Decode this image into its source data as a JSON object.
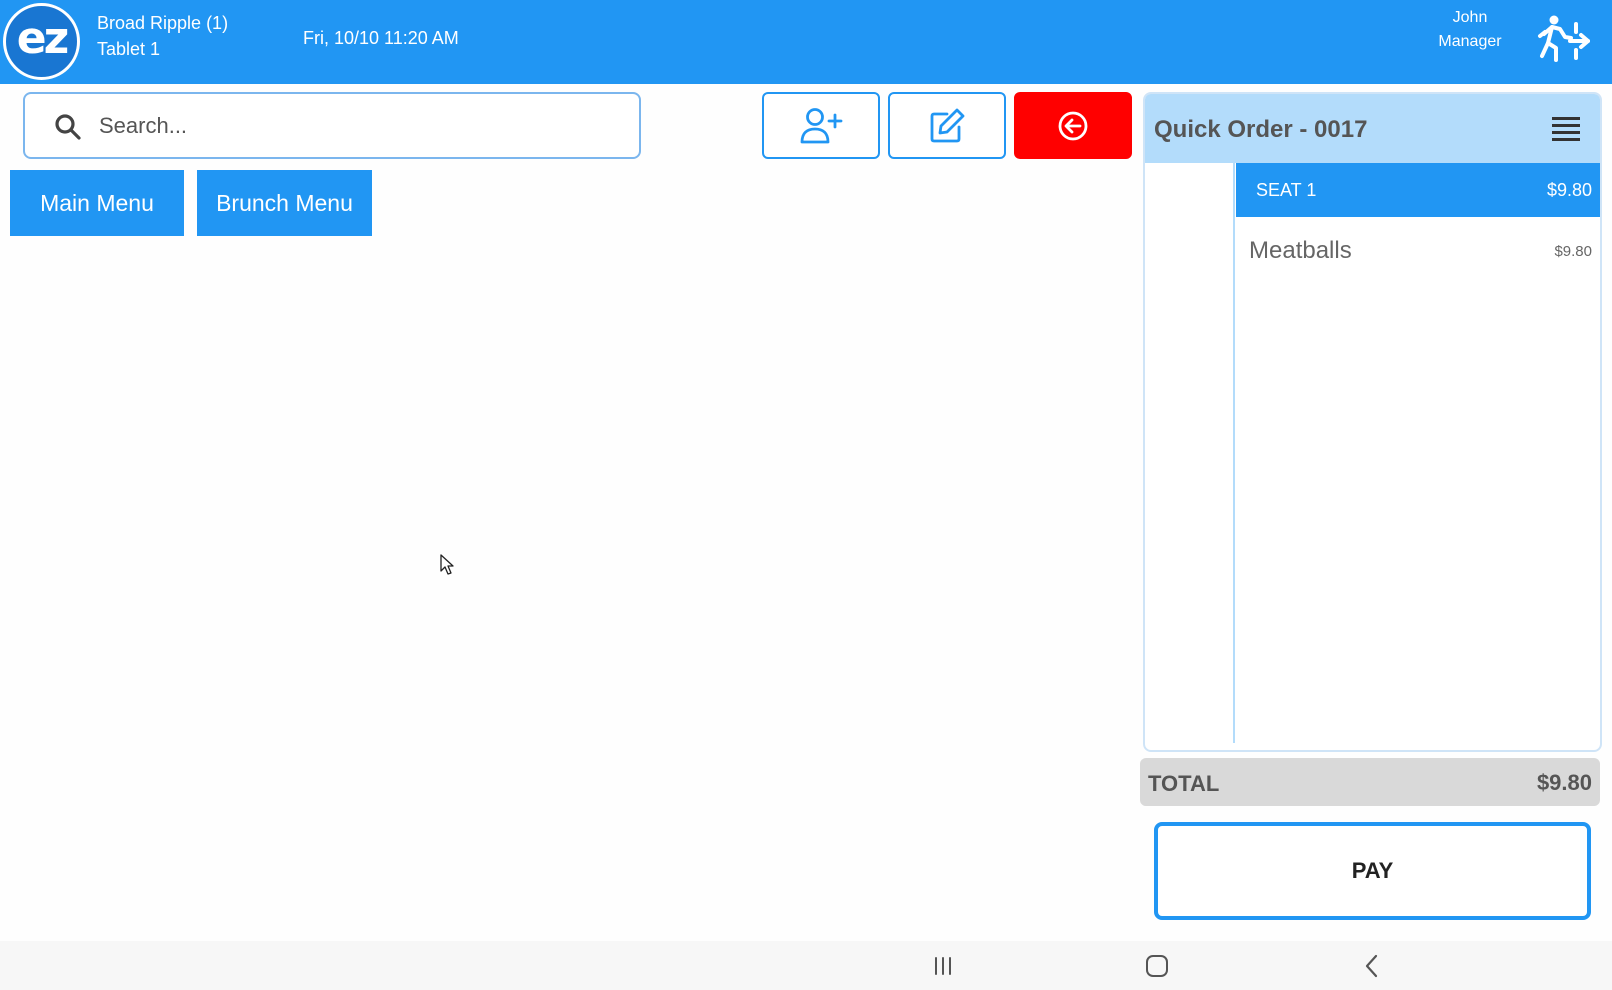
{
  "header": {
    "logo_text": "ez",
    "location": "Broad Ripple (1)",
    "device": "Tablet 1",
    "datetime": "Fri, 10/10 11:20 AM",
    "user_name": "John",
    "user_role": "Manager",
    "logout_icon": "exit-running-icon"
  },
  "search": {
    "placeholder": "Search...",
    "icon": "search-icon"
  },
  "toolbar": {
    "add_customer_icon": "user-plus-icon",
    "edit_icon": "edit-pencil-icon",
    "back_icon": "circle-arrow-left-icon"
  },
  "menus": [
    {
      "label": "Main Menu"
    },
    {
      "label": "Brunch Menu"
    }
  ],
  "order": {
    "title": "Quick Order - 0017",
    "menu_icon": "hamburger-icon",
    "seat": {
      "label": "SEAT 1",
      "amount": "$9.80"
    },
    "items": [
      {
        "name": "Meatballs",
        "price": "$9.80"
      }
    ],
    "total_label": "TOTAL",
    "total_amount": "$9.80",
    "pay_label": "PAY"
  },
  "colors": {
    "primary": "#2196f3",
    "danger": "#ff0000",
    "panel_header": "#b3dcfb",
    "total_bg": "#d9d9d9"
  },
  "system_nav": {
    "recent_icon": "recent-apps-icon",
    "home_icon": "home-icon",
    "back_icon": "back-chevron-icon"
  }
}
